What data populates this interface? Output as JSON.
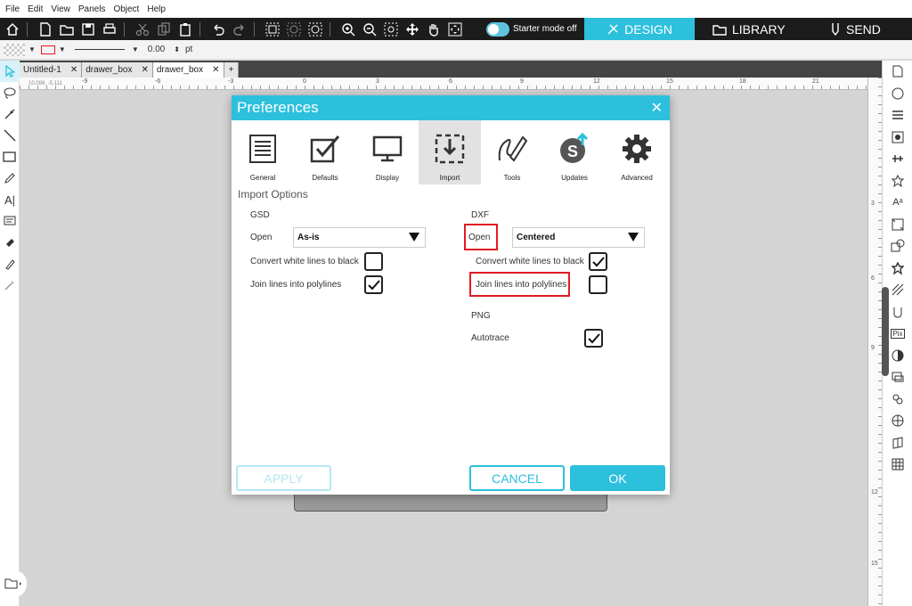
{
  "menu": [
    "File",
    "Edit",
    "View",
    "Panels",
    "Object",
    "Help"
  ],
  "toolbar": {
    "starter_mode": "Starter mode off",
    "design": "DESIGN",
    "library": "LIBRARY",
    "send": "SEND"
  },
  "line_props": {
    "weight": "0.00",
    "unit": "pt"
  },
  "doc_tabs": [
    "Untitled-1",
    "drawer_box",
    "drawer_box"
  ],
  "ruler": {
    "coords": "10.099, -5.111",
    "h_ticks": [
      "-9",
      "-6",
      "-3",
      "0",
      "3",
      "6",
      "9",
      "12",
      "15",
      "18",
      "21"
    ],
    "v_ticks": [
      "3",
      "6",
      "9",
      "12",
      "15"
    ]
  },
  "dialog": {
    "title": "Preferences",
    "tabs": [
      "General",
      "Defaults",
      "Display",
      "Import",
      "Tools",
      "Updates",
      "Advanced"
    ],
    "active_tab": "Import",
    "section": "Import Options",
    "gsd": {
      "heading": "GSD",
      "open_label": "Open",
      "open_value": "As-is",
      "convert_label": "Convert white lines to black",
      "convert_checked": false,
      "join_label": "Join lines into polylines",
      "join_checked": true
    },
    "dxf": {
      "heading": "DXF",
      "open_label": "Open",
      "open_value": "Centered",
      "convert_label": "Convert white lines to black",
      "convert_checked": true,
      "join_label": "Join lines into polylines",
      "join_checked": false
    },
    "png": {
      "heading": "PNG",
      "autotrace_label": "Autotrace",
      "autotrace_checked": true
    },
    "buttons": {
      "apply": "APPLY",
      "cancel": "CANCEL",
      "ok": "OK"
    }
  },
  "colors": {
    "accent": "#2cc0dd",
    "highlight": "#e01b24",
    "toolbar": "#1c1c1c"
  }
}
